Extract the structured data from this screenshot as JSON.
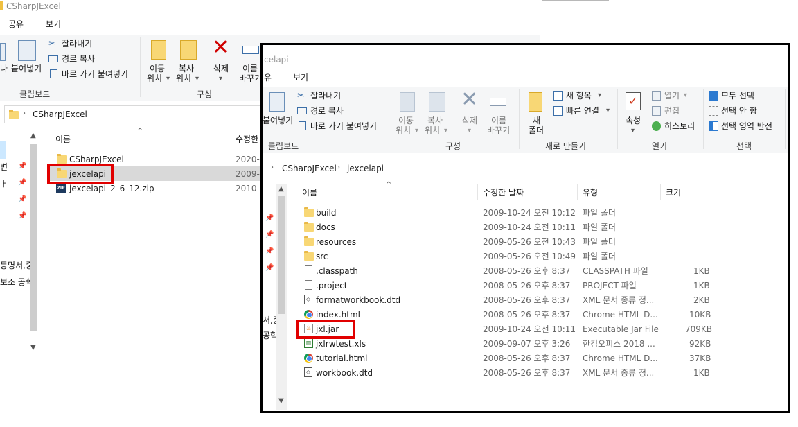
{
  "bg_window": {
    "title": "CSharpJExcel",
    "tabs": [
      "공유",
      "보기"
    ],
    "clipboard": {
      "paste_partial": "붙여넣기",
      "cut": "잘라내기",
      "copy_path": "경로 복사",
      "paste_shortcut": "바로 가기 붙여넣기",
      "group": "클립보드",
      "left_fragment": "나"
    },
    "organize": {
      "move_to": [
        "이동",
        "위치"
      ],
      "copy_to": [
        "복사",
        "위치"
      ],
      "delete": "삭제",
      "rename": [
        "이름",
        "바꾸기"
      ],
      "group": "구성"
    },
    "address": "CSharpJExcel",
    "columns": {
      "name": "이름",
      "modified": "수정한"
    },
    "nav_fragments": [
      "변",
      "ㅏ",
      "등명서,중",
      "보조 공학"
    ],
    "files": [
      {
        "name": "CSharpJExcel",
        "date": "2020-1",
        "icon": "folder-icon"
      },
      {
        "name": "jexcelapi",
        "date": "2009-1",
        "icon": "folder-icon"
      },
      {
        "name": "jexcelapi_2_6_12.zip",
        "date": "2010-0",
        "icon": "zip-icon"
      }
    ]
  },
  "fg_window": {
    "title": "celapi",
    "tabs": [
      "유",
      "보기"
    ],
    "clipboard": {
      "paste": "붙여넣기",
      "cut": "잘라내기",
      "copy_path": "경로 복사",
      "paste_shortcut": "바로 가기 붙여넣기",
      "group": "클립보드"
    },
    "organize": {
      "move_to": [
        "이동",
        "위치"
      ],
      "copy_to": [
        "복사",
        "위치"
      ],
      "delete": "삭제",
      "rename": [
        "이름",
        "바꾸기"
      ],
      "group": "구성"
    },
    "new": {
      "new_folder": [
        "새",
        "폴더"
      ],
      "new_item": "새 항목",
      "easy_access": "빠른 연결",
      "group": "새로 만들기"
    },
    "open": {
      "properties": "속성",
      "open": "열기",
      "edit": "편집",
      "history": "히스토리",
      "group": "열기"
    },
    "select": {
      "select_all": "모두 선택",
      "select_none": "선택 안 함",
      "invert": "선택 영역 반전",
      "group": "선택"
    },
    "nav_fragments": [
      "서,중",
      "공학"
    ],
    "breadcrumb": [
      "CSharpJExcel",
      "jexcelapi"
    ],
    "columns": {
      "name": "이름",
      "modified": "수정한 날짜",
      "type": "유형",
      "size": "크기"
    },
    "files": [
      {
        "name": "build",
        "date": "2009-10-24 오전 10:12",
        "type": "파일 폴더",
        "size": "",
        "icon": "folder-icon"
      },
      {
        "name": "docs",
        "date": "2009-10-24 오전 10:11",
        "type": "파일 폴더",
        "size": "",
        "icon": "folder-icon"
      },
      {
        "name": "resources",
        "date": "2009-05-26 오전 10:43",
        "type": "파일 폴더",
        "size": "",
        "icon": "folder-icon"
      },
      {
        "name": "src",
        "date": "2009-05-26 오전 10:49",
        "type": "파일 폴더",
        "size": "",
        "icon": "folder-icon"
      },
      {
        "name": ".classpath",
        "date": "2008-05-26 오후 8:37",
        "type": "CLASSPATH 파일",
        "size": "1KB",
        "icon": "file-icon"
      },
      {
        "name": ".project",
        "date": "2008-05-26 오후 8:37",
        "type": "PROJECT 파일",
        "size": "1KB",
        "icon": "file-icon"
      },
      {
        "name": "formatworkbook.dtd",
        "date": "2008-05-26 오후 8:37",
        "type": "XML 문서 종류 정...",
        "size": "2KB",
        "icon": "dtd-icon"
      },
      {
        "name": "index.html",
        "date": "2008-05-26 오후 8:37",
        "type": "Chrome HTML D...",
        "size": "10KB",
        "icon": "chrome-icon"
      },
      {
        "name": "jxl.jar",
        "date": "2009-10-24 오전 10:11",
        "type": "Executable Jar File",
        "size": "709KB",
        "icon": "jar-icon"
      },
      {
        "name": "jxlrwtest.xls",
        "date": "2009-09-07 오후 3:26",
        "type": "한컴오피스 2018 ...",
        "size": "92KB",
        "icon": "xls-icon"
      },
      {
        "name": "tutorial.html",
        "date": "2008-05-26 오후 8:37",
        "type": "Chrome HTML D...",
        "size": "37KB",
        "icon": "chrome-icon"
      },
      {
        "name": "workbook.dtd",
        "date": "2008-05-26 오후 8:37",
        "type": "XML 문서 종류 정...",
        "size": "1KB",
        "icon": "dtd-icon"
      }
    ]
  },
  "colors": {
    "highlight": "#e10000",
    "folder": "#f8d775",
    "delete": "#d00000",
    "select_blue": "#2b79d0"
  }
}
